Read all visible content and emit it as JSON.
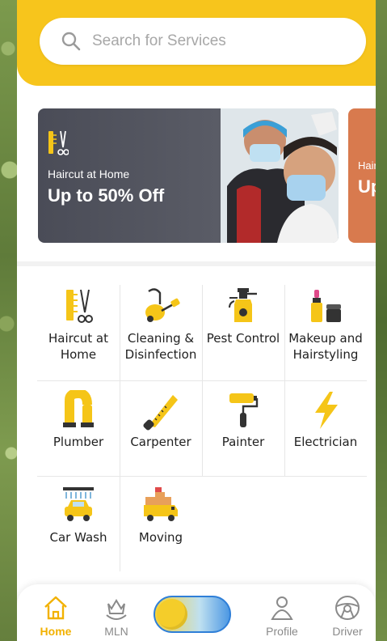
{
  "search": {
    "placeholder": "Search for Services"
  },
  "banners": [
    {
      "subtitle": "Haircut at Home",
      "title": "Up to 50% Off"
    },
    {
      "subtitle": "Hairc",
      "title": "Up"
    }
  ],
  "services": [
    {
      "label": "Haircut at Home",
      "icon": "haircut-icon"
    },
    {
      "label": "Cleaning & Disinfection",
      "icon": "vacuum-icon"
    },
    {
      "label": "Pest Control",
      "icon": "spray-icon"
    },
    {
      "label": "Makeup and Hairstyling",
      "icon": "makeup-icon"
    },
    {
      "label": "Plumber",
      "icon": "pipe-icon"
    },
    {
      "label": "Carpenter",
      "icon": "saw-icon"
    },
    {
      "label": "Painter",
      "icon": "paint-roller-icon"
    },
    {
      "label": "Electrician",
      "icon": "lightning-icon"
    },
    {
      "label": "Car Wash",
      "icon": "car-wash-icon"
    },
    {
      "label": "Moving",
      "icon": "truck-icon"
    }
  ],
  "nav": {
    "home": "Home",
    "mln": "MLN",
    "profile": "Profile",
    "driver": "Driver"
  },
  "colors": {
    "accent": "#f7c51c",
    "active_nav": "#f2b100"
  }
}
